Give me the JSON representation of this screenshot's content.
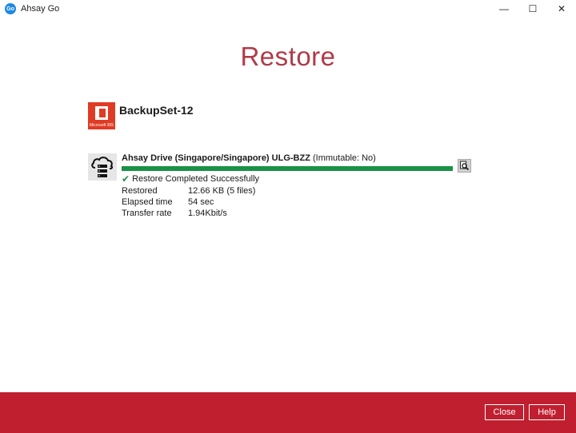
{
  "window": {
    "app_icon_text": "Go",
    "title": "Ahsay Go",
    "controls": {
      "minimize": "—",
      "maximize": "☐",
      "close": "✕"
    }
  },
  "page": {
    "heading": "Restore"
  },
  "backupset": {
    "logo_text": "Microsoft 365",
    "name": "BackupSet-12"
  },
  "destination": {
    "name": "Ahsay Drive (Singapore/Singapore) ULG-BZZ",
    "immutable_note": "(Immutable: No)",
    "progress_fraction": 1.0,
    "status": "Restore Completed Successfully",
    "details": [
      {
        "label": "Restored",
        "value": "12.66 KB (5 files)"
      },
      {
        "label": "Elapsed time",
        "value": "54 sec"
      },
      {
        "label": "Transfer rate",
        "value": "1.94Kbit/s"
      }
    ]
  },
  "footer": {
    "close_label": "Close",
    "help_label": "Help"
  },
  "colors": {
    "accent_red": "#c01f2f",
    "heading_red": "#b03a48",
    "progress_green": "#1a9146",
    "office_orange": "#e03b24"
  }
}
